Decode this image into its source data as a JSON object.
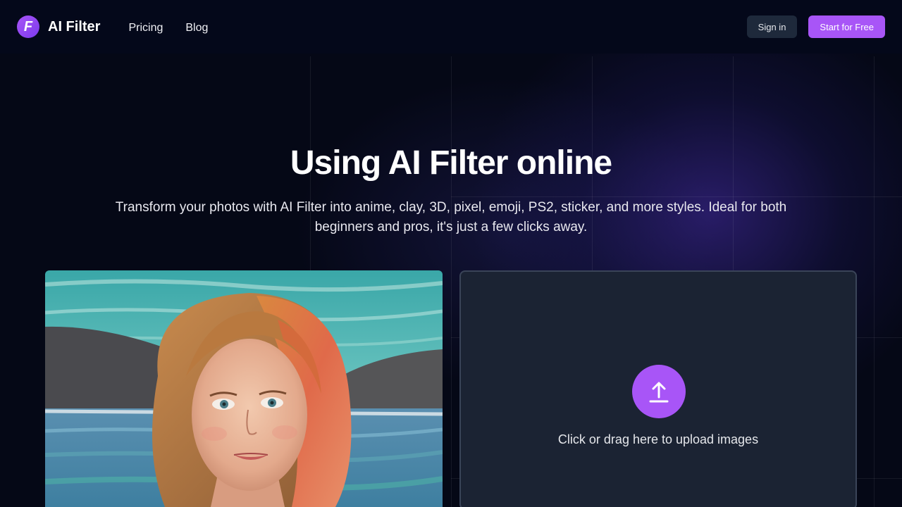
{
  "header": {
    "logo_letter": "F",
    "brand": "AI Filter",
    "nav": [
      "Pricing",
      "Blog"
    ],
    "signin_label": "Sign in",
    "start_label": "Start for Free"
  },
  "hero": {
    "title": "Using AI Filter online",
    "subtitle": "Transform your photos with AI Filter into anime, clay, 3D, pixel, emoji, PS2, sticker, and more styles. Ideal for both beginners and pros, it's just a few clicks away."
  },
  "upload": {
    "text": "Click or drag here to upload images"
  },
  "colors": {
    "accent": "#a855f7",
    "background": "#050816",
    "upload_bg": "#1b2333",
    "signin_bg": "#1e293b"
  },
  "icons": {
    "logo": "f-letter-logo-icon",
    "upload": "upload-arrow-icon"
  }
}
